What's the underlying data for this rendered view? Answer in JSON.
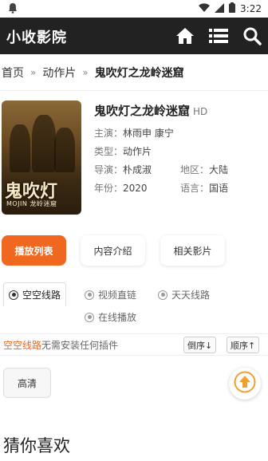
{
  "status_bar": {
    "left_icon": "notification-icon",
    "time": "3:22",
    "icons": [
      "wifi-icon",
      "signal-icon",
      "battery-icon"
    ]
  },
  "app": {
    "title": "小收影院"
  },
  "nav_icons": [
    "home-icon",
    "menu-list-icon",
    "search-icon"
  ],
  "breadcrumb": {
    "home": "首页",
    "category": "动作片",
    "current": "鬼吹灯之龙岭迷窟",
    "separator": "»"
  },
  "movie": {
    "title": "鬼吹灯之龙岭迷窟",
    "quality": "HD",
    "cast_label": "主演：",
    "cast": "林雨申 康宁",
    "type_label": "类型：",
    "type": "动作片",
    "director_label": "导演：",
    "director": "朴成淑",
    "region_label": "地区：",
    "region": "大陆",
    "year_label": "年份：",
    "year": "2020",
    "language_label": "语言：",
    "language": "国语",
    "poster_title": "鬼吹灯",
    "poster_subtitle": "MOJIN 龙岭迷窟"
  },
  "tabs": [
    {
      "label": "播放列表",
      "active": true
    },
    {
      "label": "内容介绍",
      "active": false
    },
    {
      "label": "相关影片",
      "active": false
    }
  ],
  "sources": [
    {
      "label": "空空线路",
      "active": true
    },
    {
      "label": "视频直链",
      "active": false
    },
    {
      "label": "天天线路",
      "active": false
    },
    {
      "label": "在线播放",
      "active": false
    }
  ],
  "source_info": {
    "highlight": "空空线路",
    "text": "无需安装任何插件"
  },
  "sort": {
    "desc": "倒序↓",
    "asc": "顺序↑"
  },
  "episodes": [
    "高清"
  ],
  "section": {
    "guess": "猜你喜欢"
  },
  "colors": {
    "accent": "#f0671f",
    "appbar": "#222222",
    "scroll_top": "#f0a030"
  }
}
